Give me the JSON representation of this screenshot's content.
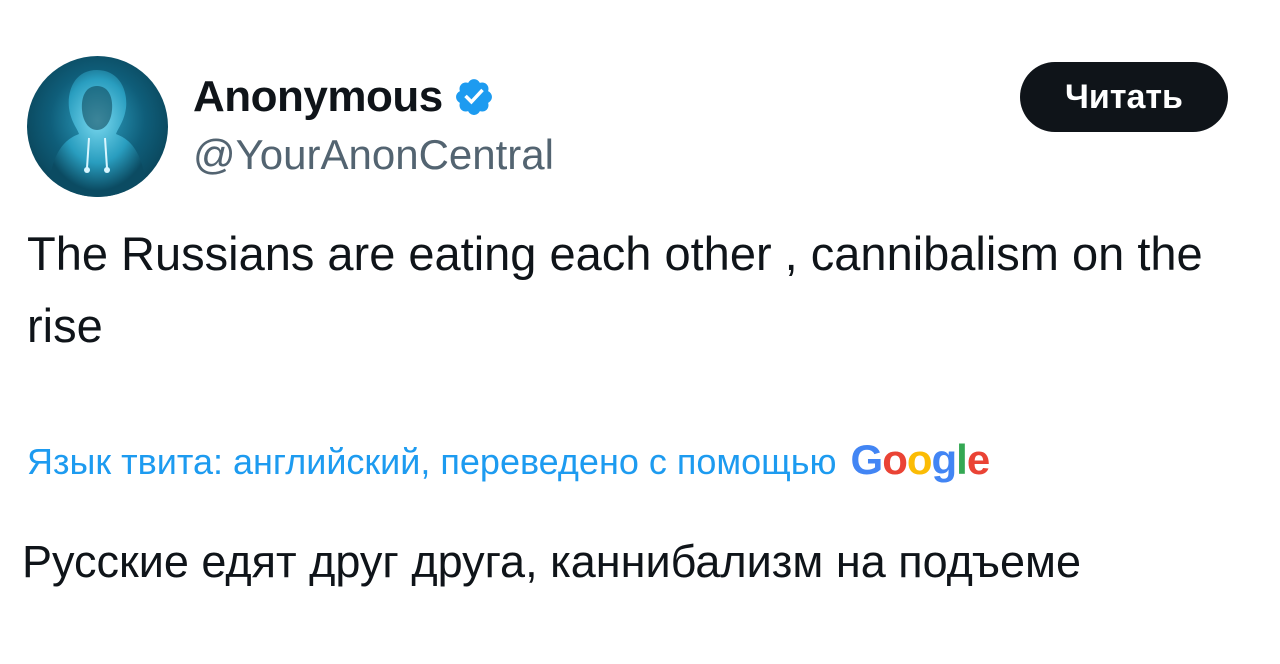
{
  "author": {
    "display_name": "Anonymous",
    "handle": "@YourAnonCentral",
    "verified_icon": "verified-badge-icon",
    "avatar": "hooded-figure-avatar"
  },
  "actions": {
    "follow_label": "Читать"
  },
  "tweet": {
    "text": "The Russians are eating each other , cannibalism on the rise"
  },
  "translation": {
    "notice": "Язык твита: английский, переведено с помощью",
    "provider": [
      "G",
      "o",
      "o",
      "g",
      "l",
      "e"
    ],
    "translated_text": "Русские едят друг друга, каннибализм на подъеме"
  },
  "colors": {
    "accent": "#1d9bf0",
    "text": "#0f1419",
    "secondary_text": "#536471",
    "button_bg": "#0f1419"
  }
}
